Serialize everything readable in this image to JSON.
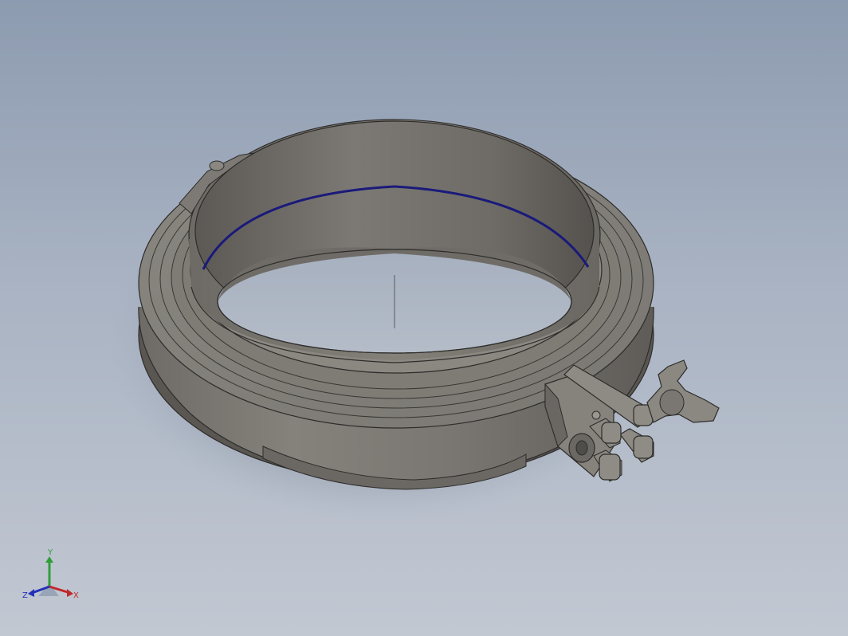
{
  "viewport": {
    "background_top": "#8d9bb0",
    "background_bottom": "#c2c8d2"
  },
  "model": {
    "part_color": "#77746f",
    "part_shadow": "#4e4c49",
    "seal_line_color": "#1a1a7a"
  },
  "triad": {
    "x_label": "X",
    "y_label": "Y",
    "z_label": "Z",
    "x_color": "#c0282a",
    "y_color": "#2f9e3a",
    "z_color": "#2530b8"
  }
}
